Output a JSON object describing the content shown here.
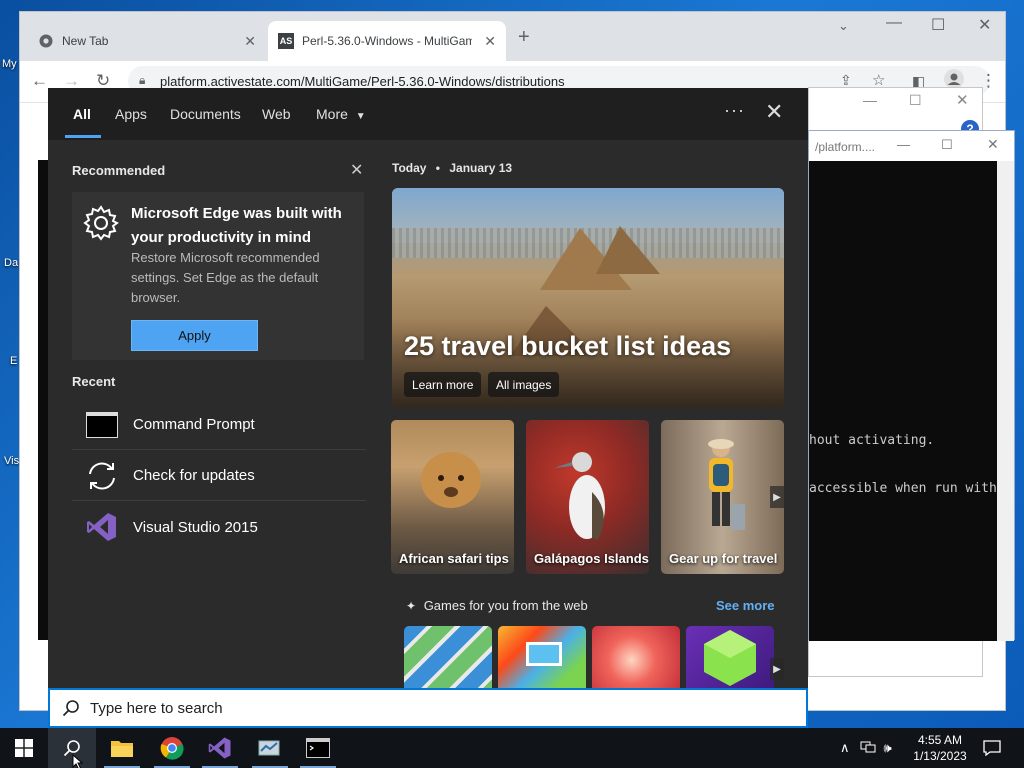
{
  "desktop": {
    "labels": [
      "My",
      "Da",
      "E",
      "Vis"
    ]
  },
  "browser": {
    "tabs": [
      {
        "label": "New Tab",
        "active": false
      },
      {
        "label": "Perl-5.36.0-Windows - MultiGam",
        "active": true
      }
    ],
    "url": "platform.activestate.com/MultiGame/Perl-5.36.0-Windows/distributions"
  },
  "bg_windows": {
    "title_fragment": "/platform....",
    "terminal_lines": [
      "hout activating.",
      "accessible when run with"
    ]
  },
  "search_panel": {
    "tabs": {
      "all": "All",
      "apps": "Apps",
      "documents": "Documents",
      "web": "Web",
      "more": "More"
    },
    "recommended": {
      "heading": "Recommended",
      "title": "Microsoft Edge was built with your productivity in mind",
      "description": "Restore Microsoft recommended settings. Set Edge as the default browser.",
      "apply_label": "Apply"
    },
    "recent": {
      "heading": "Recent",
      "items": [
        {
          "label": "Command Prompt",
          "icon": "command-prompt-icon"
        },
        {
          "label": "Check for updates",
          "icon": "refresh-icon"
        },
        {
          "label": "Visual Studio 2015",
          "icon": "visual-studio-icon"
        }
      ]
    },
    "today": {
      "label": "Today",
      "date": "January 13"
    },
    "hero": {
      "title": "25 travel bucket list ideas",
      "learn_more": "Learn more",
      "all_images": "All images"
    },
    "tiles": [
      {
        "label": "African safari tips"
      },
      {
        "label": "Galápagos Islands"
      },
      {
        "label": "Gear up for travel"
      }
    ],
    "games": {
      "heading": "Games for you from the web",
      "see_more": "See more"
    }
  },
  "search_box": {
    "placeholder": "Type here to search"
  },
  "taskbar": {
    "time": "4:55 AM",
    "date": "1/13/2023"
  },
  "colors": {
    "accent": "#4ea4f2",
    "taskbar": "#101418",
    "panel": "#2b2b2b"
  }
}
